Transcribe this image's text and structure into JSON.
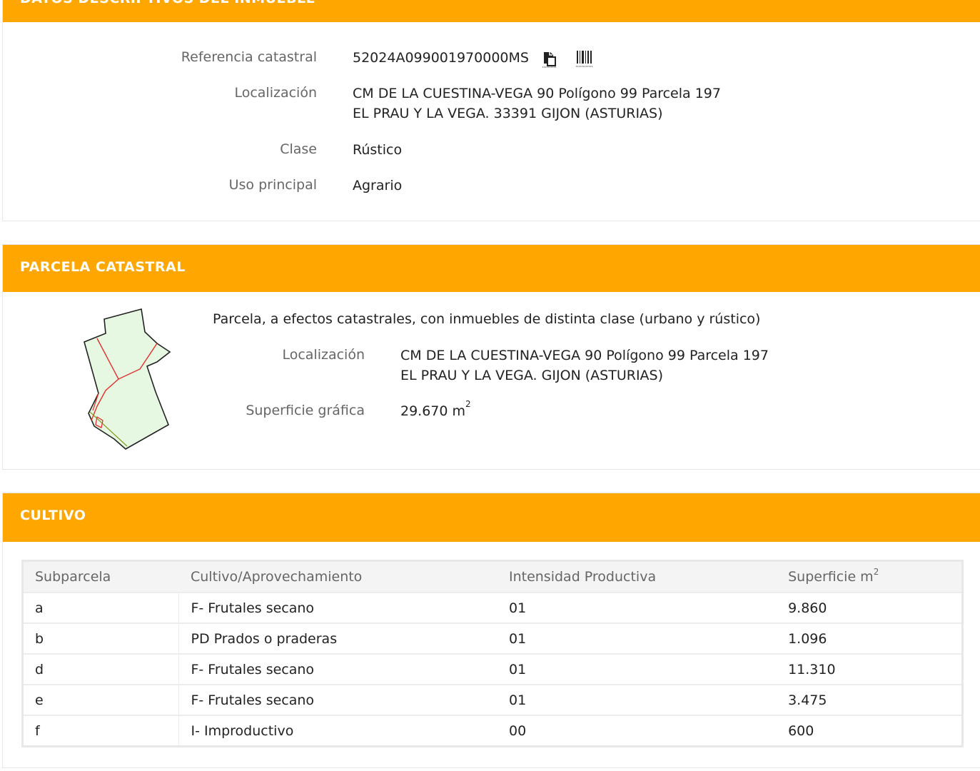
{
  "datos": {
    "title": "DATOS DESCRIPTIVOS DEL INMUEBLE",
    "ref_label": "Referencia catastral",
    "ref_value": "52024A099001970000MS",
    "loc_label": "Localización",
    "loc_line1": "CM DE LA CUESTINA-VEGA 90 Polígono 99 Parcela 197",
    "loc_line2": "EL PRAU Y LA VEGA. 33391 GIJON (ASTURIAS)",
    "clase_label": "Clase",
    "clase_value": "Rústico",
    "uso_label": "Uso principal",
    "uso_value": "Agrario",
    "icons": [
      "copy-icon",
      "barcode-icon"
    ]
  },
  "parcela": {
    "title": "PARCELA CATASTRAL",
    "description": "Parcela, a efectos catastrales, con inmuebles de distinta clase (urbano y rústico)",
    "loc_label": "Localización",
    "loc_line1": "CM DE LA CUESTINA-VEGA 90 Polígono 99 Parcela 197",
    "loc_line2": "EL PRAU Y LA VEGA. GIJON (ASTURIAS)",
    "sup_label": "Superficie gráfica",
    "sup_value": "29.670 m",
    "sup_exp": "2"
  },
  "cultivo": {
    "title": "CULTIVO",
    "headers": [
      "Subparcela",
      "Cultivo/Aprovechamiento",
      "Intensidad Productiva",
      "Superficie m"
    ],
    "header_exp": "2",
    "rows": [
      [
        "a",
        "F- Frutales secano",
        "01",
        "9.860"
      ],
      [
        "b",
        "PD Prados o praderas",
        "01",
        "1.096"
      ],
      [
        "d",
        "F- Frutales secano",
        "01",
        "11.310"
      ],
      [
        "e",
        "F- Frutales secano",
        "01",
        "3.475"
      ],
      [
        "f",
        "I- Improductivo",
        "00",
        "600"
      ]
    ]
  },
  "colors": {
    "accent": "#ffa700",
    "label": "#666666",
    "text": "#222222"
  }
}
